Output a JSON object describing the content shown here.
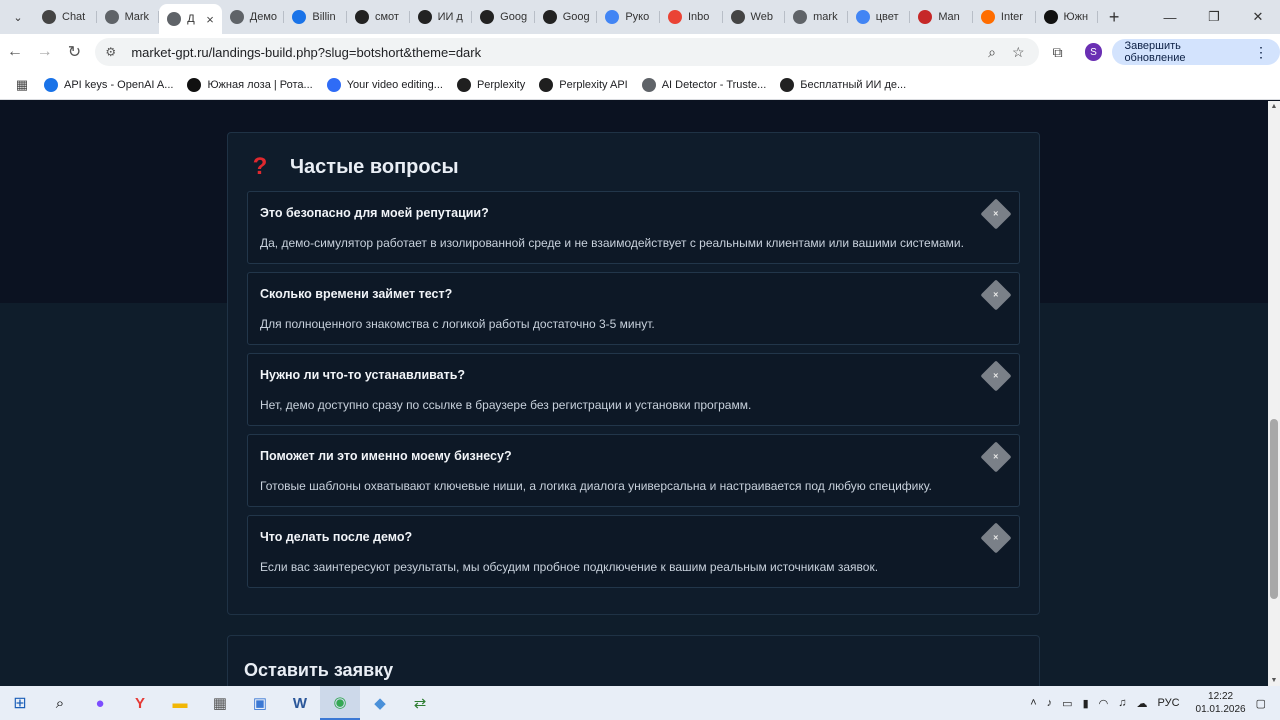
{
  "browser": {
    "tabs": [
      {
        "label": "Chat",
        "icon": "openai-icon",
        "color": "#444444"
      },
      {
        "label": "Mark",
        "icon": "globe-icon",
        "color": "#5f6368"
      },
      {
        "label": "Д",
        "icon": "globe-icon",
        "color": "#5f6368",
        "active": true
      },
      {
        "label": "Демо",
        "icon": "globe-icon",
        "color": "#5f6368"
      },
      {
        "label": "Billin",
        "icon": "globe-icon",
        "color": "#1a73e8"
      },
      {
        "label": "смот",
        "icon": "app-icon",
        "color": "#222222"
      },
      {
        "label": "ИИ д",
        "icon": "app-icon",
        "color": "#222222"
      },
      {
        "label": "Goog",
        "icon": "app-icon",
        "color": "#222222"
      },
      {
        "label": "Goog",
        "icon": "app-icon",
        "color": "#222222"
      },
      {
        "label": "Руко",
        "icon": "google-icon",
        "color": "#4285f4"
      },
      {
        "label": "Inbo",
        "icon": "gmail-icon",
        "color": "#ea4335"
      },
      {
        "label": "Web",
        "icon": "app-icon",
        "color": "#444444"
      },
      {
        "label": "mark",
        "icon": "globe-icon",
        "color": "#5f6368"
      },
      {
        "label": "цвет",
        "icon": "google-icon",
        "color": "#4285f4"
      },
      {
        "label": "Man",
        "icon": "app-icon",
        "color": "#c62828"
      },
      {
        "label": "Inter",
        "icon": "app-icon",
        "color": "#ff6d00"
      },
      {
        "label": "Южн",
        "icon": "app-icon",
        "color": "#111111"
      }
    ],
    "url": "market-gpt.ru/landings-build.php?slug=botshort&theme=dark",
    "update_label": "Завершить обновление",
    "avatar_letter": "S",
    "bookmarks": [
      {
        "label": "API keys - OpenAI A...",
        "color": "#1a73e8"
      },
      {
        "label": "Южная лоза | Рота...",
        "color": "#111111"
      },
      {
        "label": "Your video editing...",
        "color": "#2f6cf6"
      },
      {
        "label": "Perplexity",
        "color": "#1f1f1f"
      },
      {
        "label": "Perplexity API",
        "color": "#1f1f1f"
      },
      {
        "label": "AI Detector - Truste...",
        "color": "#5f6368"
      },
      {
        "label": "Бесплатный ИИ де...",
        "color": "#222222"
      }
    ]
  },
  "faq": {
    "title": "Частые вопросы",
    "items": [
      {
        "q": "Это безопасно для моей репутации?",
        "a": "Да, демо-симулятор работает в изолированной среде и не взаимодействует с реальными клиентами или вашими системами."
      },
      {
        "q": "Сколько времени займет тест?",
        "a": "Для полноценного знакомства с логикой работы достаточно 3-5 минут."
      },
      {
        "q": "Нужно ли что-то устанавливать?",
        "a": "Нет, демо доступно сразу по ссылке в браузере без регистрации и установки программ."
      },
      {
        "q": "Поможет ли это именно моему бизнесу?",
        "a": "Готовые шаблоны охватывают ключевые ниши, а логика диалога универсальна и настраивается под любую специфику."
      },
      {
        "q": "Что делать после демо?",
        "a": "Если вас заинтересуют результаты, мы обсудим пробное подключение к вашим реальным источникам заявок."
      }
    ],
    "toggle_glyph": "×"
  },
  "form": {
    "title": "Оставить заявку"
  },
  "taskbar": {
    "lang": "РУС",
    "time": "12:22",
    "date": "01.01.2026"
  }
}
